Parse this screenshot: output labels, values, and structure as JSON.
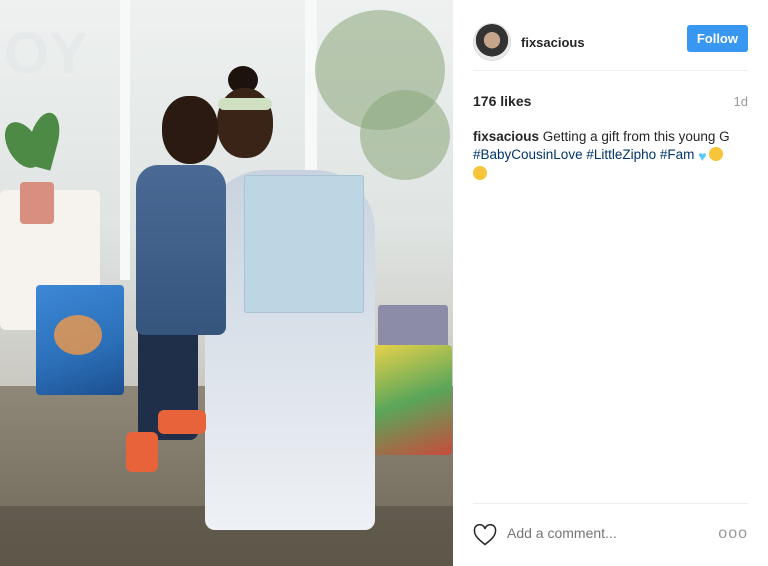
{
  "post": {
    "username": "fixsacious",
    "follow_label": "Follow",
    "likes": "176 likes",
    "age": "1d",
    "caption": {
      "username": "fixsacious",
      "text": "Getting a gift from this young G",
      "hashtags": [
        "#BabyCousinLove",
        "#LittleZipho",
        "#Fam"
      ]
    },
    "comment_placeholder": "Add a comment...",
    "more_label": "ooo"
  },
  "colors": {
    "follow_bg": "#3897f0",
    "hashtag": "#003569"
  },
  "icons": {
    "like": "heart-outline-icon",
    "more": "more-options-icon",
    "heart_emoji": "blue-heart-emoji",
    "face_emoji_1": "heart-eyes-emoji",
    "face_emoji_2": "wink-kiss-emoji"
  }
}
